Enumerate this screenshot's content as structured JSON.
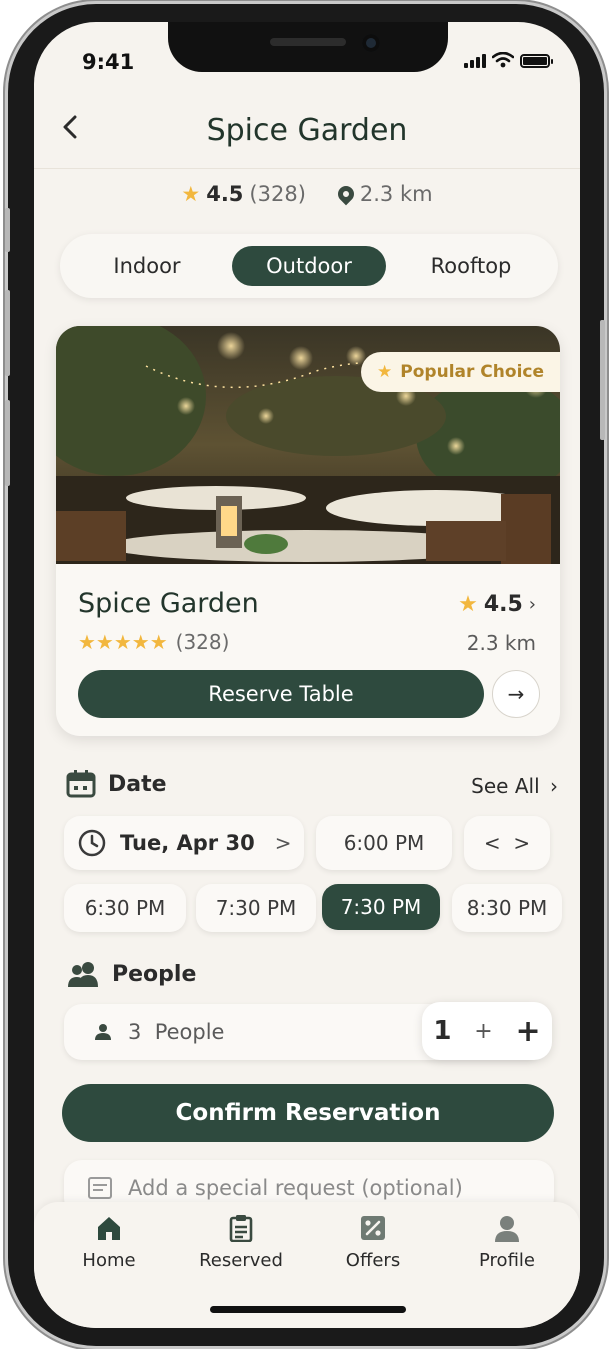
{
  "status_bar": {
    "time": "9:41"
  },
  "header": {
    "title": "Spice Garden",
    "back_icon": "back-chevron-icon"
  },
  "summary": {
    "rating": "4.5",
    "reviews": "(328)",
    "distance": "2.3 km"
  },
  "seating_tabs": [
    {
      "label": "Indoor",
      "active": false
    },
    {
      "label": "Outdoor",
      "active": true
    },
    {
      "label": "Rooftop",
      "active": false
    }
  ],
  "card": {
    "badge": "Popular Choice",
    "name": "Spice Garden",
    "stars": "★★★★★",
    "reviews": "(328)",
    "rating": "4.5",
    "distance": "2.3 km",
    "reserve_label": "Reserve Table",
    "arrow": "→"
  },
  "date_section": {
    "title": "Date",
    "see_all": "See All",
    "date_value": "Tue, Apr 30",
    "date_chevron": ">",
    "time_primary": "6:00 PM",
    "nav": "<  >",
    "times": [
      {
        "label": "6:30 PM",
        "active": false
      },
      {
        "label": "7:30 PM",
        "active": false
      },
      {
        "label": "7:30 PM",
        "active": true
      },
      {
        "label": "8:30 PM",
        "active": false
      }
    ]
  },
  "people_section": {
    "title": "People",
    "value": "3  People",
    "stepper_value": "1",
    "minus": "+",
    "plus": "+"
  },
  "confirm_label": "Confirm Reservation",
  "request_placeholder": "Add a special request (optional)",
  "tabbar": [
    {
      "label": "Home",
      "icon": "home-icon"
    },
    {
      "label": "Reserved",
      "icon": "clipboard-icon"
    },
    {
      "label": "Offers",
      "icon": "percent-tag-icon"
    },
    {
      "label": "Profile",
      "icon": "user-icon"
    }
  ],
  "colors": {
    "primary": "#2e4a3e",
    "accent": "#f2b73e",
    "background": "#f6f3ee",
    "badge_text": "#b0842a"
  }
}
